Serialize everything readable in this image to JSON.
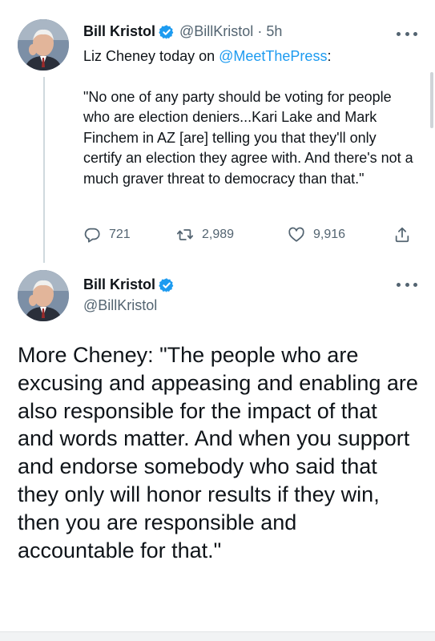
{
  "colors": {
    "accent": "#1d9bf0",
    "muted": "#536471",
    "text": "#0f1419",
    "thread_line": "#cfd9de"
  },
  "tweet1": {
    "author_name": "Bill Kristol",
    "handle": "@BillKristol",
    "separator": "·",
    "time": "5h",
    "intro_text": "Liz Cheney today on ",
    "mention": "@MeetThePress",
    "intro_suffix": ":",
    "quote": "\"No one of any party should be voting for people who are election deniers...Kari Lake and Mark Finchem in AZ [are] telling you that they'll only certify an election they agree with. And there's not a much graver threat to democracy than that.\"",
    "replies": "721",
    "retweets": "2,989",
    "likes": "9,916",
    "icons": [
      "verified-badge-icon",
      "more-icon",
      "reply-icon",
      "retweet-icon",
      "like-icon",
      "share-icon"
    ]
  },
  "tweet2": {
    "author_name": "Bill Kristol",
    "handle": "@BillKristol",
    "text": "More Cheney: \"The people who are excusing and appeasing and enabling are also responsible for the impact of that and words matter. And when you support and endorse somebody who said that they only will honor results if they win, then you are responsible and accountable for that.\"",
    "icons": [
      "verified-badge-icon",
      "more-icon"
    ]
  }
}
